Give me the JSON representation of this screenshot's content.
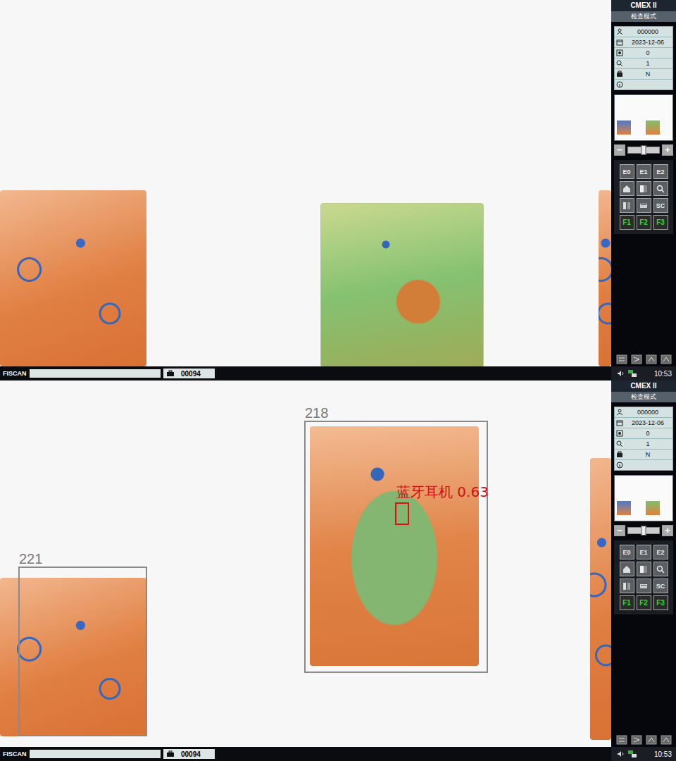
{
  "panes": [
    {
      "sidebar": {
        "title": "CMEX II",
        "mode": "检查模式",
        "info": [
          {
            "value": "000000"
          },
          {
            "value": "2023-12-06"
          },
          {
            "value": "0"
          },
          {
            "value": "1"
          },
          {
            "value": "N"
          },
          {
            "value": ""
          }
        ],
        "zoom": {
          "minus": "−",
          "plus": "+",
          "level": 0.5
        },
        "buttons": [
          {
            "kind": "text",
            "label": "E0"
          },
          {
            "kind": "text",
            "label": "E1"
          },
          {
            "kind": "text",
            "label": "E2"
          },
          {
            "kind": "icon",
            "label": ""
          },
          {
            "kind": "icon",
            "label": ""
          },
          {
            "kind": "icon",
            "label": ""
          },
          {
            "kind": "icon",
            "label": ""
          },
          {
            "kind": "icon",
            "label": ""
          },
          {
            "kind": "text",
            "label": "SC"
          },
          {
            "kind": "function",
            "label": "F1"
          },
          {
            "kind": "function",
            "label": "F2"
          },
          {
            "kind": "function",
            "label": "F3"
          }
        ]
      },
      "status_bar": {
        "brand": "FISCAN",
        "field": "",
        "count": "00094",
        "time": "10:53"
      },
      "frames": [],
      "detections": []
    },
    {
      "sidebar": {
        "title": "CMEX II",
        "mode": "检查模式",
        "info": [
          {
            "value": "000000"
          },
          {
            "value": "2023-12-06"
          },
          {
            "value": "0"
          },
          {
            "value": "1"
          },
          {
            "value": "N"
          },
          {
            "value": ""
          }
        ],
        "zoom": {
          "minus": "−",
          "plus": "+",
          "level": 0.5
        },
        "buttons": [
          {
            "kind": "text",
            "label": "E0"
          },
          {
            "kind": "text",
            "label": "E1"
          },
          {
            "kind": "text",
            "label": "E2"
          },
          {
            "kind": "icon",
            "label": ""
          },
          {
            "kind": "icon",
            "label": ""
          },
          {
            "kind": "icon",
            "label": ""
          },
          {
            "kind": "icon",
            "label": ""
          },
          {
            "kind": "icon",
            "label": ""
          },
          {
            "kind": "text",
            "label": "SC"
          },
          {
            "kind": "function",
            "label": "F1"
          },
          {
            "kind": "function",
            "label": "F2"
          },
          {
            "kind": "function",
            "label": "F3"
          }
        ]
      },
      "status_bar": {
        "brand": "FISCAN",
        "field": "",
        "count": "00094",
        "time": "10:53"
      },
      "frames": [
        {
          "label": "218"
        },
        {
          "label": "221"
        }
      ],
      "detections": [
        {
          "label": "蓝牙耳机 0.63"
        }
      ]
    }
  ]
}
